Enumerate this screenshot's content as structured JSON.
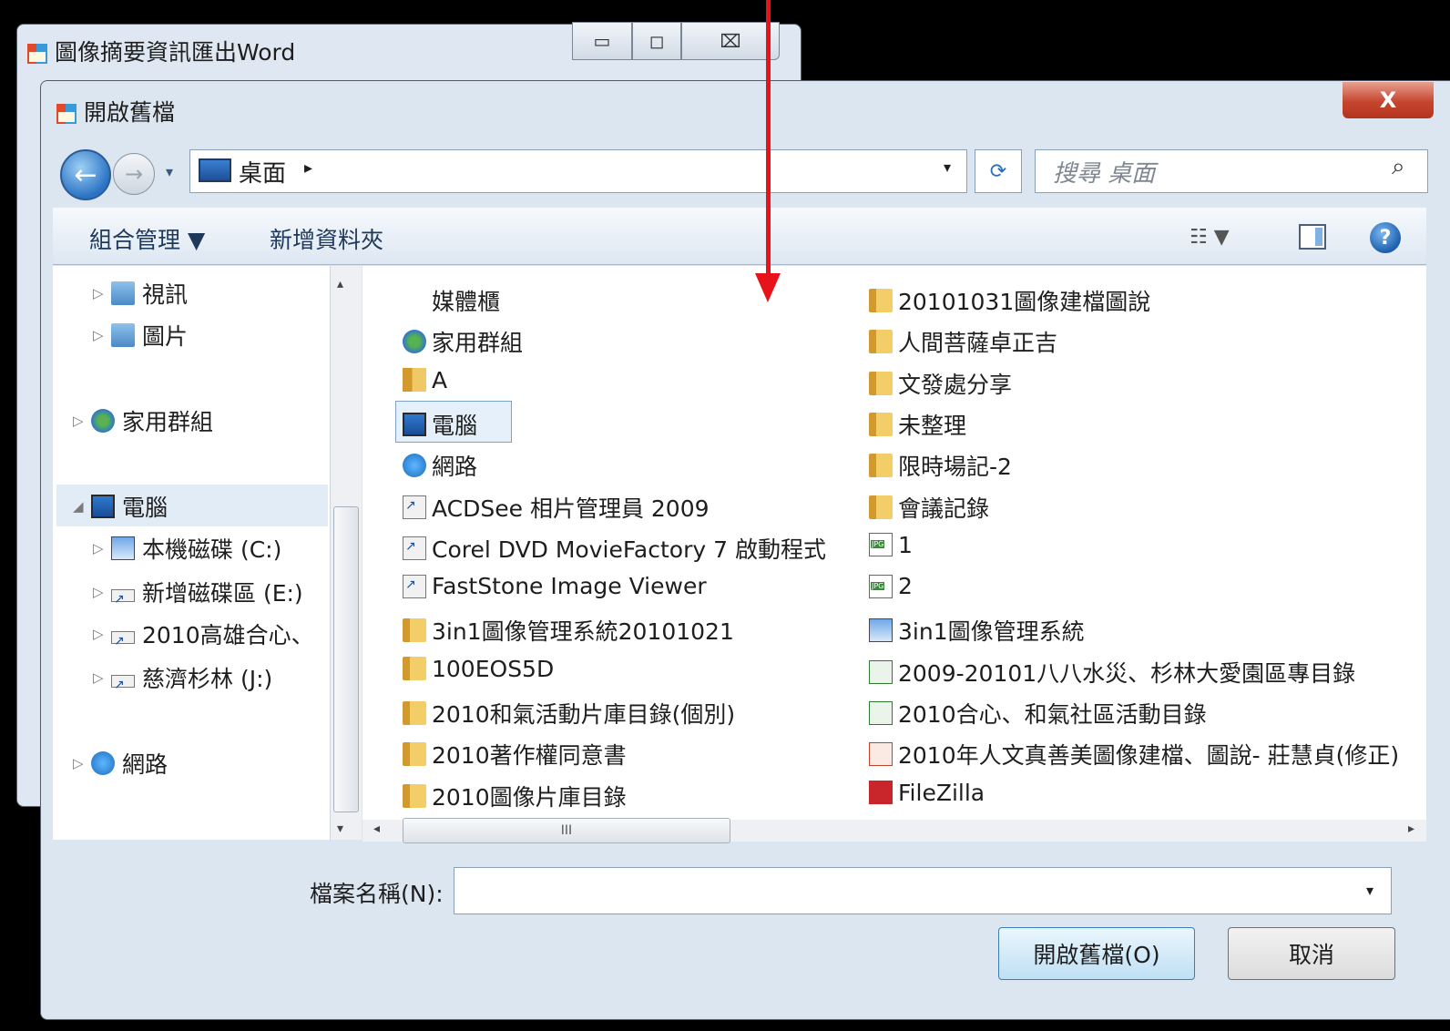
{
  "parent_window": {
    "title": "圖像摘要資訊匯出Word",
    "controls": {
      "minimize": "▭",
      "maximize": "◻",
      "close": "⌧"
    }
  },
  "dialog": {
    "title": "開啟舊檔",
    "close_glyph": "X",
    "nav": {
      "back_glyph": "←",
      "forward_glyph": "→",
      "history_glyph": "▾"
    },
    "address": {
      "location": "桌面",
      "chevron": "▸",
      "dropdown_glyph": "▾",
      "refresh_glyph": "⟳"
    },
    "search": {
      "placeholder": "搜尋 桌面",
      "icon_glyph": "⌕"
    },
    "toolbar": {
      "organize": "組合管理 ▼",
      "new_folder": "新增資料夾",
      "view_glyph": "☷ ▼",
      "help_glyph": "?"
    },
    "nav_pane": {
      "items": [
        {
          "label": "視訊",
          "icon": "video-library-icon"
        },
        {
          "label": "圖片",
          "icon": "pictures-library-icon"
        },
        {
          "label": "家用群組",
          "icon": "homegroup-icon"
        },
        {
          "label": "電腦",
          "icon": "computer-icon"
        },
        {
          "label": "本機磁碟 (C:)",
          "icon": "drive-c-icon"
        },
        {
          "label": "新增磁碟區 (E:)",
          "icon": "drive-e-icon"
        },
        {
          "label": "2010高雄合心、",
          "icon": "drive-icon"
        },
        {
          "label": "慈濟杉林 (J:)",
          "icon": "drive-j-icon"
        },
        {
          "label": "網路",
          "icon": "network-icon"
        }
      ],
      "tri_collapsed": "▷",
      "tri_expanded": "◢"
    },
    "files_col1": [
      {
        "name": "媒體櫃",
        "type": "library"
      },
      {
        "name": "家用群組",
        "type": "home"
      },
      {
        "name": "A",
        "type": "user"
      },
      {
        "name": "電腦",
        "type": "pc"
      },
      {
        "name": "網路",
        "type": "net"
      },
      {
        "name": "ACDSee 相片管理員 2009",
        "type": "short"
      },
      {
        "name": "Corel DVD MovieFactory 7 啟動程式",
        "type": "short"
      },
      {
        "name": "FastStone Image Viewer",
        "type": "short"
      },
      {
        "name": "3in1圖像管理系統20101021",
        "type": "folder"
      },
      {
        "name": "100EOS5D",
        "type": "folder"
      },
      {
        "name": "2010和氣活動片庫目錄(個別)",
        "type": "folder"
      },
      {
        "name": "2010著作權同意書",
        "type": "folder"
      },
      {
        "name": "2010圖像片庫目錄",
        "type": "folder"
      }
    ],
    "files_col2": [
      {
        "name": "20101031圖像建檔圖說",
        "type": "folder"
      },
      {
        "name": "人間菩薩卓正吉",
        "type": "folder"
      },
      {
        "name": "文發處分享",
        "type": "folder"
      },
      {
        "name": "未整理",
        "type": "folder"
      },
      {
        "name": "限時場記-2",
        "type": "folder"
      },
      {
        "name": "會議記錄",
        "type": "folder"
      },
      {
        "name": "1",
        "type": "jpg"
      },
      {
        "name": "2",
        "type": "jpg"
      },
      {
        "name": "3in1圖像管理系統",
        "type": "app"
      },
      {
        "name": "2009-20101八八水災、杉林大愛園區專目錄",
        "type": "doc"
      },
      {
        "name": "2010合心、和氣社區活動目錄",
        "type": "doc"
      },
      {
        "name": "2010年人文真善美圖像建檔、圖說- 莊慧貞(修正)",
        "type": "ppt"
      },
      {
        "name": "FileZilla",
        "type": "zilla"
      }
    ],
    "scroll": {
      "thumb_grip": "III",
      "left": "◂",
      "right": "▸",
      "up": "▴",
      "down": "▾"
    },
    "filename": {
      "label": "檔案名稱(N):",
      "value": "",
      "dropdown_glyph": "▾"
    },
    "buttons": {
      "open": "開啟舊檔(O)",
      "cancel": "取消"
    }
  },
  "annotation": {
    "color": "#e8121a"
  }
}
